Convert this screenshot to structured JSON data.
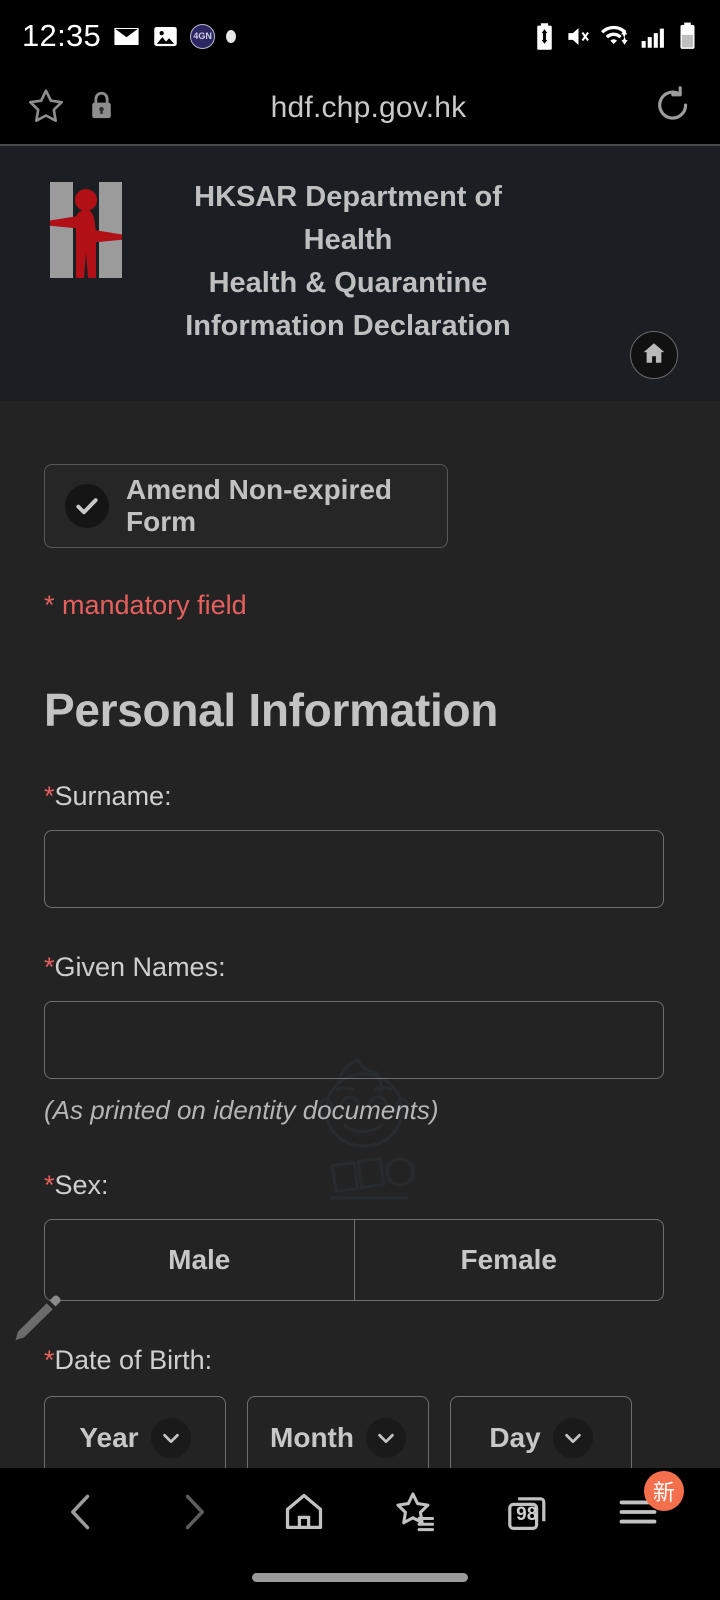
{
  "status_bar": {
    "time": "12:35",
    "left_icons": [
      "mail-icon",
      "image-icon",
      "app-icon",
      "dot-indicator"
    ],
    "app_icon_label": "4GN",
    "right_icons": [
      "battery-saver-icon",
      "mute-vibrate-icon",
      "wifi-icon",
      "signal-icon",
      "battery-icon"
    ]
  },
  "browser": {
    "url": "hdf.chp.gov.hk",
    "left_icons": [
      "bookmark-star-icon",
      "lock-icon"
    ],
    "right_icons": [
      "reload-icon"
    ]
  },
  "site_header": {
    "title_line1": "HKSAR Department of Health",
    "title_line2": "Health & Quarantine",
    "title_line3": "Information Declaration",
    "logo": "dh-person-logo",
    "home_button": "home-icon"
  },
  "form": {
    "amend_button": {
      "label": "Amend Non-expired Form",
      "icon": "check-icon"
    },
    "mandatory_note": "* mandatory field",
    "section_title": "Personal Information",
    "surname": {
      "label": "Surname:",
      "required_mark": "*",
      "value": "",
      "placeholder": ""
    },
    "given_names": {
      "label": "Given Names:",
      "required_mark": "*",
      "value": "",
      "placeholder": "",
      "hint": "(As printed on identity documents)"
    },
    "sex": {
      "label": "Sex:",
      "required_mark": "*",
      "options": [
        "Male",
        "Female"
      ],
      "selected": ""
    },
    "date_of_birth": {
      "label": "Date of Birth:",
      "required_mark": "*",
      "year": "Year",
      "month": "Month",
      "day": "Day"
    }
  },
  "floating": {
    "edit_icon": "pencil-icon"
  },
  "bottom_nav": {
    "items": [
      {
        "name": "back",
        "icon": "chevron-left-icon",
        "label": ""
      },
      {
        "name": "forward",
        "icon": "chevron-right-icon",
        "label": ""
      },
      {
        "name": "home",
        "icon": "home-icon",
        "label": ""
      },
      {
        "name": "bookmarks",
        "icon": "star-list-icon",
        "label": ""
      },
      {
        "name": "tabs",
        "icon": "tabs-icon",
        "label": "98"
      },
      {
        "name": "menu",
        "icon": "menu-icon",
        "label": "",
        "badge": "新"
      }
    ]
  },
  "colors": {
    "page_background": "#232323",
    "header_background": "#1b1f24",
    "accent_red": "#e8605e",
    "logo_red": "#b11116",
    "logo_grey": "#9b9b9b",
    "text_primary": "#c7c7c7",
    "badge_orange": "#f4704d"
  }
}
